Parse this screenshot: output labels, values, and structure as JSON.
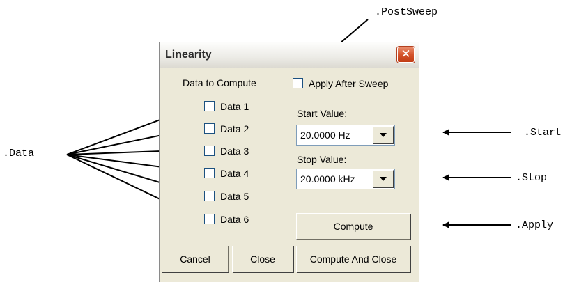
{
  "dialog": {
    "title": "Linearity",
    "close_glyph": "✕",
    "data_header": "Data to Compute",
    "apply_after_sweep_label": "Apply After Sweep",
    "data_items": [
      "Data 1",
      "Data 2",
      "Data 3",
      "Data 4",
      "Data 5",
      "Data 6"
    ],
    "start_label": "Start Value:",
    "start_value": "20.0000  Hz",
    "stop_label": "Stop Value:",
    "stop_value": "20.0000 kHz",
    "compute_label": "Compute",
    "cancel_label": "Cancel",
    "close_label": "Close",
    "compute_close_label": "Compute And Close"
  },
  "callouts": {
    "postsweep": ".PostSweep",
    "data": ".Data",
    "start": ".Start",
    "stop": ".Stop",
    "apply": ".Apply"
  },
  "icons": [
    "close-icon",
    "chevron-down-icon"
  ],
  "colors": {
    "dialog_bg": "#ece9d8",
    "close_button": "#d4542c",
    "checkbox_border": "#1c5180"
  }
}
